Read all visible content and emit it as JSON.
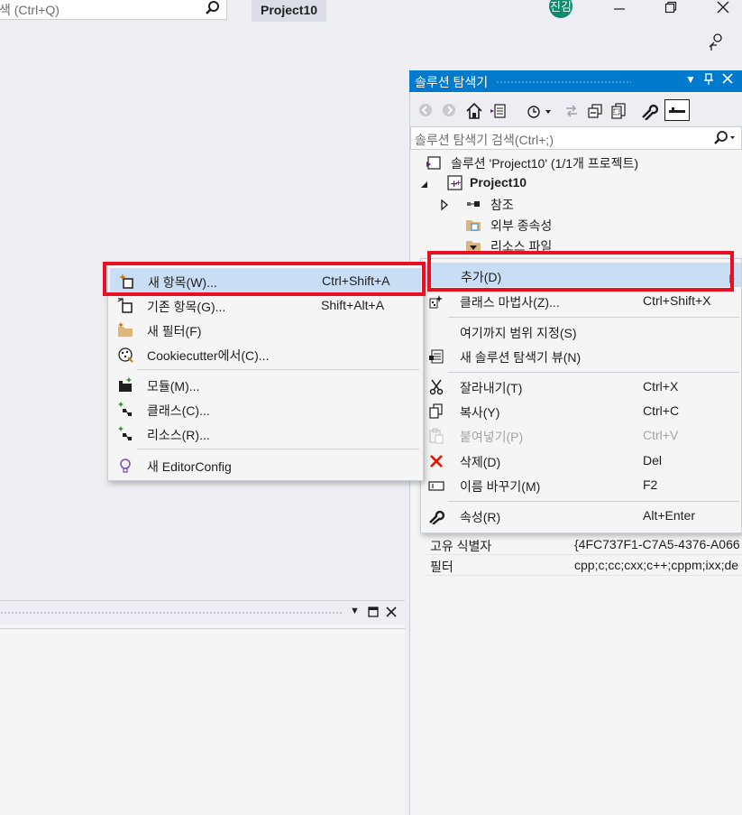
{
  "titlebar": {
    "search_placeholder": "색 (Ctrl+Q)",
    "project_title": "Project10",
    "avatar_initials": "진김"
  },
  "solution_explorer": {
    "title": "솔루션 탐색기",
    "search_placeholder": "솔루션 탐색기 검색(Ctrl+;)",
    "tree": {
      "solution": "솔루션 'Project10' (1/1개 프로젝트)",
      "project": "Project10",
      "references": "참조",
      "external_deps": "외부 종속성",
      "resource_files": "리소스 파일"
    }
  },
  "properties": {
    "rows": [
      {
        "key": "고유 식별자",
        "value": "{4FC737F1-C7A5-4376-A066"
      },
      {
        "key": "필터",
        "value": "cpp;c;cc;cxx;c++;cppm;ixx;de"
      }
    ]
  },
  "context_menu": {
    "items": [
      {
        "label": "추가(D)",
        "shortcut": "",
        "icon": "none"
      },
      {
        "label": "클래스 마법사(Z)...",
        "shortcut": "Ctrl+Shift+X",
        "icon": "class-wizard-icon"
      },
      {
        "label": "여기까지 범위 지정(S)",
        "shortcut": "",
        "icon": "none"
      },
      {
        "label": "새 솔루션 탐색기 뷰(N)",
        "shortcut": "",
        "icon": "new-view-icon"
      },
      {
        "label": "잘라내기(T)",
        "shortcut": "Ctrl+X",
        "icon": "scissors-icon"
      },
      {
        "label": "복사(Y)",
        "shortcut": "Ctrl+C",
        "icon": "copy-icon"
      },
      {
        "label": "붙여넣기(P)",
        "shortcut": "Ctrl+V",
        "icon": "paste-icon"
      },
      {
        "label": "삭제(D)",
        "shortcut": "Del",
        "icon": "delete-icon"
      },
      {
        "label": "이름 바꾸기(M)",
        "shortcut": "F2",
        "icon": "rename-icon"
      },
      {
        "label": "속성(R)",
        "shortcut": "Alt+Enter",
        "icon": "wrench-icon"
      }
    ]
  },
  "add_submenu": {
    "items": [
      {
        "label": "새 항목(W)...",
        "shortcut": "Ctrl+Shift+A",
        "icon": "new-item-icon"
      },
      {
        "label": "기존 항목(G)...",
        "shortcut": "Shift+Alt+A",
        "icon": "existing-item-icon"
      },
      {
        "label": "새 필터(F)",
        "shortcut": "",
        "icon": "new-filter-icon"
      },
      {
        "label": "Cookiecutter에서(C)...",
        "shortcut": "",
        "icon": "cookiecutter-icon"
      },
      {
        "label": "모듈(M)...",
        "shortcut": "",
        "icon": "module-icon"
      },
      {
        "label": "클래스(C)...",
        "shortcut": "",
        "icon": "class-icon"
      },
      {
        "label": "리소스(R)...",
        "shortcut": "",
        "icon": "resource-icon"
      },
      {
        "label": "새 EditorConfig",
        "shortcut": "",
        "icon": "editorconfig-icon"
      }
    ]
  },
  "colors": {
    "accent": "#007acc",
    "highlight": "#c9def5",
    "callout": "#e81123"
  }
}
